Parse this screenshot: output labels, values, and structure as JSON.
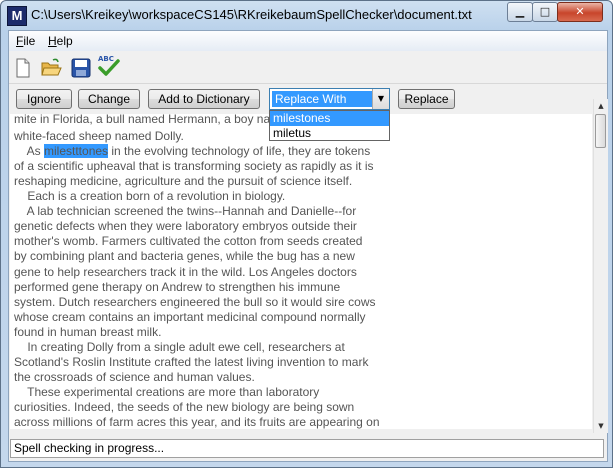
{
  "window": {
    "title": "C:\\Users\\Kreikey\\workspaceCS145\\RKreikebaumSpellChecker\\document.txt",
    "app_icon_letter": "M",
    "min_glyph": "▁",
    "max_glyph": "□",
    "close_glyph": "✕"
  },
  "menu": {
    "file": {
      "mnemonic": "F",
      "rest": "ile"
    },
    "help": {
      "mnemonic": "H",
      "rest": "elp"
    }
  },
  "toolbar": {
    "icons": [
      "new-file-icon",
      "open-folder-icon",
      "save-disk-icon",
      "spell-check-icon"
    ],
    "spell_check_text": "ABC"
  },
  "buttons": {
    "ignore": "Ignore",
    "change": "Change",
    "add_to_dictionary": "Add to Dictionary",
    "replace": "Replace"
  },
  "replace_combo": {
    "value": "Replace With",
    "options": [
      "milestones",
      "miletus"
    ],
    "selected_index": 0
  },
  "document": {
    "lines": [
      {
        "text": "mite in Florida, a bull named Hermann, a boy named",
        "clip": true
      },
      {
        "text": "white-faced sheep named Dolly."
      },
      {
        "pre": "    As ",
        "flagged": "milestttones",
        "post": " in the evolving technology of life, they are tokens"
      },
      {
        "text": "of a scientific upheaval that is transforming society as rapidly as it is"
      },
      {
        "text": "reshaping medicine, agriculture and the pursuit of science itself."
      },
      {
        "text": "    Each is a creation born of a revolution in biology."
      },
      {
        "text": "    A lab technician screened the twins--Hannah and Danielle--for"
      },
      {
        "text": "genetic defects when they were laboratory embryos outside their"
      },
      {
        "text": "mother's womb. Farmers cultivated the cotton from seeds created"
      },
      {
        "text": "by combining plant and bacteria genes, while the bug has a new"
      },
      {
        "text": "gene to help researchers track it in the wild. Los Angeles doctors"
      },
      {
        "text": "performed gene therapy on Andrew to strengthen his immune"
      },
      {
        "text": "system. Dutch researchers engineered the bull so it would sire cows"
      },
      {
        "text": "whose cream contains an important medicinal compound normally"
      },
      {
        "text": "found in human breast milk."
      },
      {
        "text": "    In creating Dolly from a single adult ewe cell, researchers at"
      },
      {
        "text": "Scotland's Roslin Institute crafted the latest living invention to mark"
      },
      {
        "text": "the crossroads of science and human values."
      },
      {
        "text": "    These experimental creations are more than laboratory"
      },
      {
        "text": "curiosities. Indeed, the seeds of the new biology are being sown"
      },
      {
        "text": "across millions of farm acres this year, and its fruits are appearing on"
      }
    ]
  },
  "scrollbar": {
    "up_glyph": "▲",
    "down_glyph": "▼",
    "position_fraction": 0.0
  },
  "status": {
    "text": "Spell checking in progress..."
  }
}
